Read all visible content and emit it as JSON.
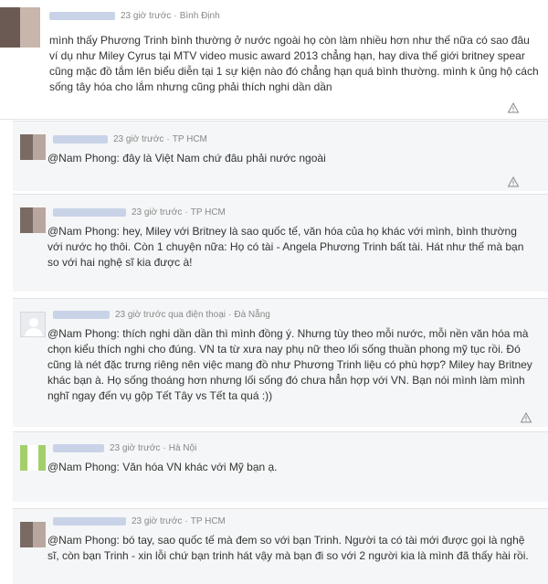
{
  "comments": [
    {
      "time": "23 giờ trước",
      "via": "",
      "location": "Bình Định",
      "avatar": "photo",
      "text": "mình thấy Phương Trinh bình thường ở nước ngoài họ còn làm nhiều hơn như thế nữa có sao đâu ví dụ như Miley Cyrus tại MTV video music award 2013 chẳng hạn, hay diva thế giới britney spear cũng mặc đồ tắm lên biểu diễn tại 1 sự kiện nào đó chẳng hạn quá bình thường. mình k ủng hộ cách sống tây hóa cho lắm nhưng cũng phải thích nghi dần dần"
    },
    {
      "time": "23 giờ trước",
      "via": "",
      "location": "TP HCM",
      "avatar": "photo",
      "text": "@Nam Phong: đây là Việt Nam chứ đâu phải nước ngoài"
    },
    {
      "time": "23 giờ trước",
      "via": "",
      "location": "TP HCM",
      "avatar": "photo",
      "text": "@Nam Phong: hey, Miley với Britney là sao quốc tế, văn hóa của họ khác với mình, bình thường với nước họ thôi. Còn 1 chuyện nữa: Họ có tài - Angela Phương Trinh bất tài. Hát như thế mà bạn so với hai nghệ sĩ kia được à!"
    },
    {
      "time": "23 giờ trước",
      "via": "qua điện thoại",
      "location": "Đà Nẵng",
      "avatar": "default",
      "text": "@Nam Phong: thích nghi dần dần thì mình đồng ý. Nhưng tùy theo mỗi nước, mỗi nền văn hóa mà chọn kiểu thích nghi cho đúng. VN ta từ xưa nay phụ nữ theo lối sống thuần phong mỹ tục rồi. Đó cũng là nét đặc trưng riêng nên việc mang đồ như Phương Trinh liệu có phù hợp? Miley hay Britney khác bạn à. Họ sống thoáng hơn nhưng lối sống đó chưa hẳn hợp với VN. Bạn nói mình làm mình nghĩ ngay đến vụ gộp Tết Tây vs Tết ta quá :))"
    },
    {
      "time": "23 giờ trước",
      "via": "",
      "location": "Hà Nội",
      "avatar": "green",
      "text": "@Nam Phong: Văn hóa VN khác với Mỹ bạn ạ."
    },
    {
      "time": "23 giờ trước",
      "via": "",
      "location": "TP HCM",
      "avatar": "photo",
      "text": "@Nam Phong: bó tay, sao quốc tế mà đem so với bạn Trinh. Người ta có tài mới được gọi là nghệ sĩ, còn bạn Trinh - xin lỗi chứ bạn trinh hát vậy mà bạn đi so với 2 người kia là mình đã thấy hài rồi."
    }
  ],
  "icons": {
    "report": "warning-triangle-icon"
  },
  "colors": {
    "meta": "#888888",
    "reply_bg": "#f5f6f7",
    "name_blur": "#c9d3e8"
  }
}
